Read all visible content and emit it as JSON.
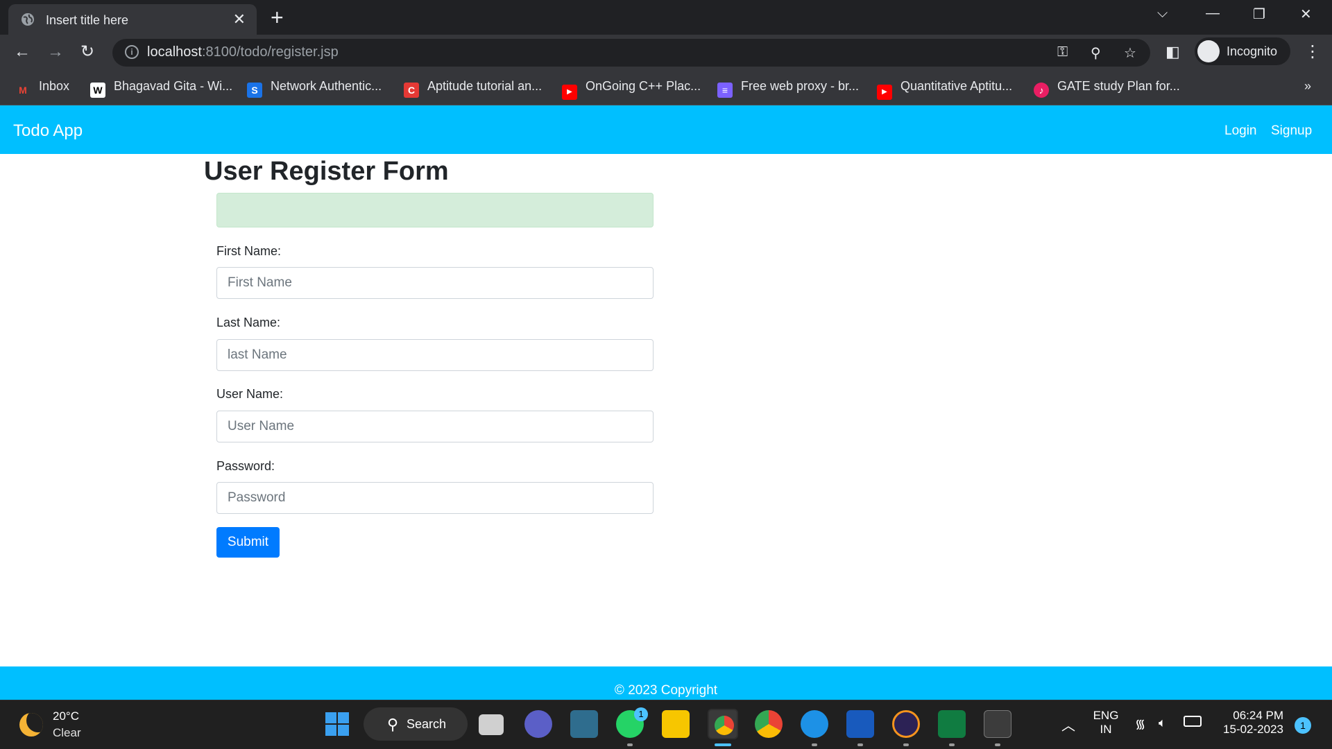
{
  "browser": {
    "tab_title": "Insert title here",
    "url_host": "localhost",
    "url_path": ":8100/todo/register.jsp",
    "profile_label": "Incognito",
    "bookmarks": [
      {
        "label": "Inbox",
        "icon": "gmail-icon",
        "color": "#ea4335"
      },
      {
        "label": "Bhagavad Gita - Wi...",
        "icon": "wikipedia-icon",
        "color": "#ffffff"
      },
      {
        "label": "Network Authentic...",
        "icon": "s-icon",
        "color": "#1a73e8"
      },
      {
        "label": "Aptitude tutorial an...",
        "icon": "c-icon",
        "color": "#e53935"
      },
      {
        "label": "OnGoing C++ Plac...",
        "icon": "youtube-icon",
        "color": "#ff0000"
      },
      {
        "label": "Free web proxy - br...",
        "icon": "proxy-icon",
        "color": "#7b61ff"
      },
      {
        "label": "Quantitative Aptitu...",
        "icon": "youtube-icon",
        "color": "#ff0000"
      },
      {
        "label": "GATE study Plan for...",
        "icon": "music-icon",
        "color": "#e91e63"
      }
    ],
    "more_bookmarks": "»"
  },
  "navbar": {
    "brand": "Todo App",
    "login": "Login",
    "signup": "Signup",
    "color": "#00bfff"
  },
  "form": {
    "heading": "User Register Form",
    "first_name_label": "First Name:",
    "first_name_placeholder": "First Name",
    "last_name_label": "Last Name:",
    "last_name_placeholder": "last Name",
    "user_name_label": "User Name:",
    "user_name_placeholder": "User Name",
    "password_label": "Password:",
    "password_placeholder": "Password",
    "submit_label": "Submit",
    "submit_color": "#007bff",
    "alert_color": "#d4edda"
  },
  "footer": {
    "copyright": "© 2023 Copyright"
  },
  "taskbar": {
    "temperature": "20°C",
    "condition": "Clear",
    "search_label": "Search",
    "language": "ENG",
    "region": "IN",
    "time": "06:24 PM",
    "date": "15-02-2023",
    "notification_count": "1",
    "whatsapp_badge": "1"
  }
}
